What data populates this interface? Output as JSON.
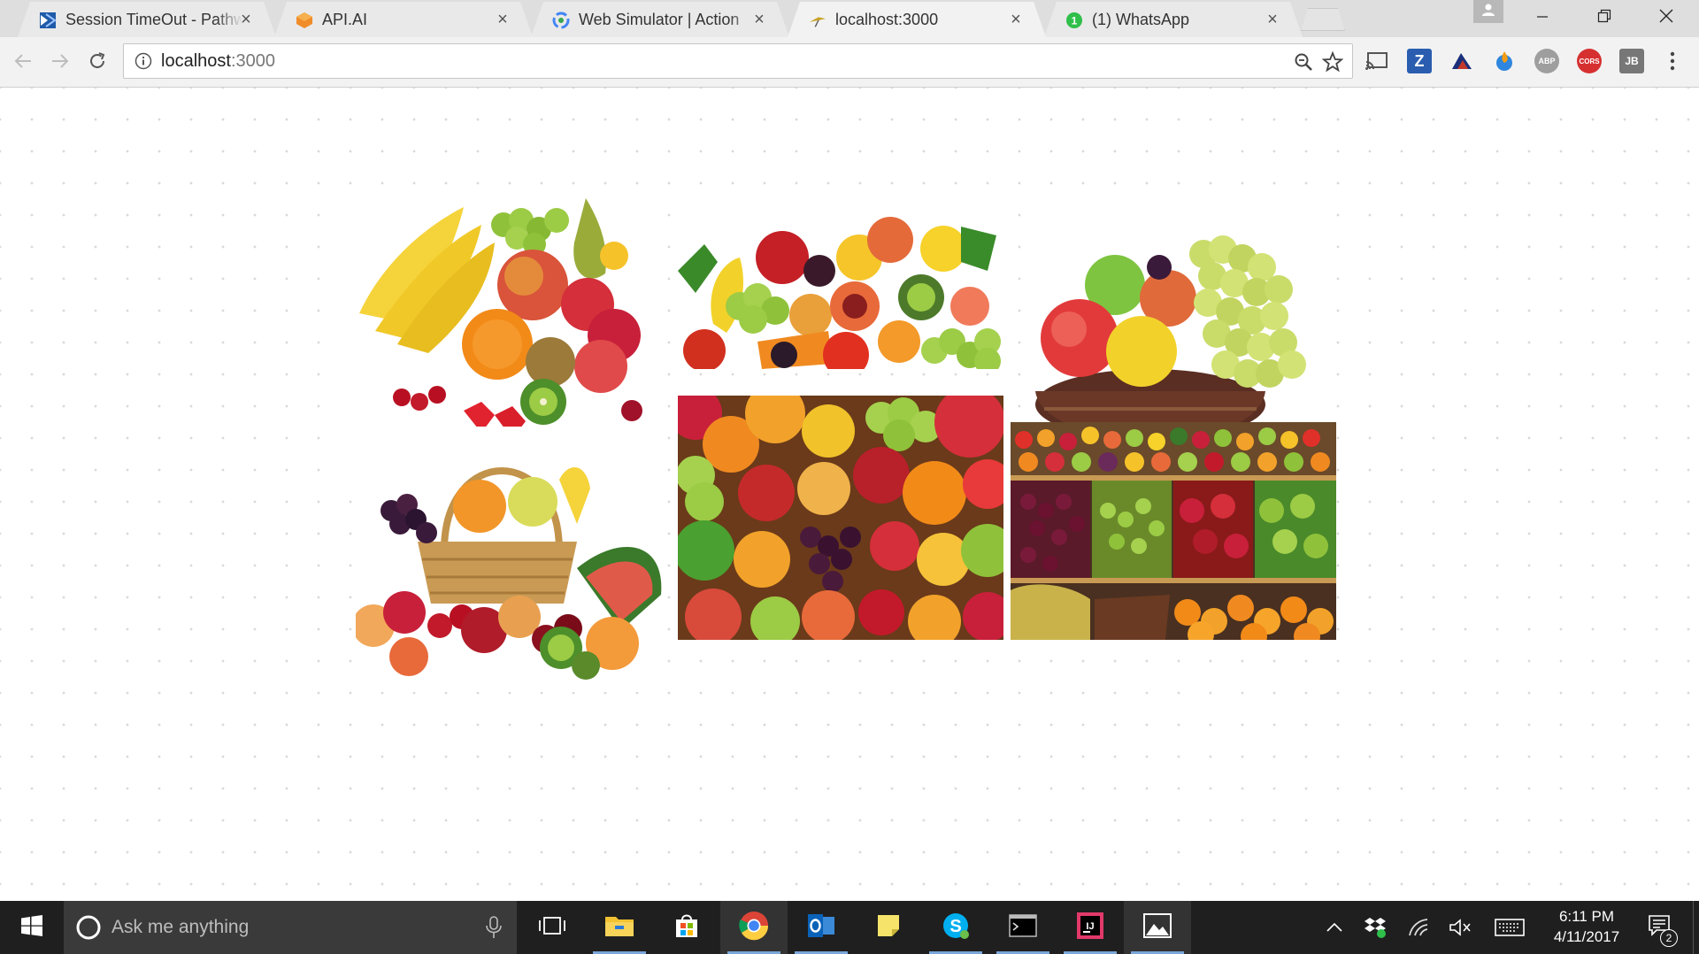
{
  "browser": {
    "tabs": [
      {
        "title": "Session TimeOut - Pathw",
        "favicon": "pathway-icon",
        "active": false
      },
      {
        "title": "API.AI",
        "favicon": "apiai-icon",
        "active": false
      },
      {
        "title": "Web Simulator  |  Action",
        "favicon": "google-icon",
        "active": false
      },
      {
        "title": "localhost:3000",
        "favicon": "kite-icon",
        "active": true
      },
      {
        "title": "(1) WhatsApp",
        "favicon": "whatsapp-icon",
        "active": false
      }
    ],
    "tab_close_glyph": "×",
    "omnibox": {
      "host": "localhost",
      "port": ":3000"
    },
    "extensions": [
      {
        "name": "cast-icon",
        "label": ""
      },
      {
        "name": "zotero-icon",
        "label": "Z"
      },
      {
        "name": "extension-icon",
        "label": ""
      },
      {
        "name": "extension-icon",
        "label": ""
      },
      {
        "name": "abp-icon",
        "label": "ABP"
      },
      {
        "name": "cors-icon",
        "label": "CORS"
      },
      {
        "name": "jb-icon",
        "label": "JB"
      }
    ]
  },
  "page": {
    "images": [
      {
        "name": "fruit-image-1",
        "subject": "banana-apple-grape-pile"
      },
      {
        "name": "fruit-image-2",
        "subject": "vegetables-and-fruit-row"
      },
      {
        "name": "fruit-image-3",
        "subject": "fruit-basket-with-grapes"
      },
      {
        "name": "fruit-image-4",
        "subject": "wicker-basket-of-fruit"
      },
      {
        "name": "fruit-image-5",
        "subject": "mixed-fruit-closeup"
      },
      {
        "name": "fruit-image-6",
        "subject": "market-fruit-stall"
      }
    ]
  },
  "taskbar": {
    "search_placeholder": "Ask me anything",
    "time": "6:11 PM",
    "date": "4/11/2017",
    "notification_count": "2"
  },
  "colors": {
    "taskbar_bg": "#1f1f1f",
    "tab_strip_bg": "#dedede",
    "active_tab_bg": "#f2f2f2",
    "accent": "#7aa6d8"
  }
}
